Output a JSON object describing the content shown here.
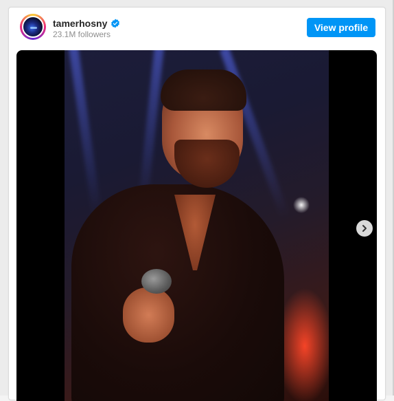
{
  "post": {
    "username": "tamerhosny",
    "verified": true,
    "followers": "23.1M followers",
    "view_profile_label": "View profile"
  },
  "icons": {
    "verified": "verified-badge-icon",
    "next": "chevron-right-icon"
  },
  "colors": {
    "button": "#0095f6",
    "verified": "#0095f6",
    "username": "#262626",
    "secondary_text": "#8e8e8e"
  }
}
